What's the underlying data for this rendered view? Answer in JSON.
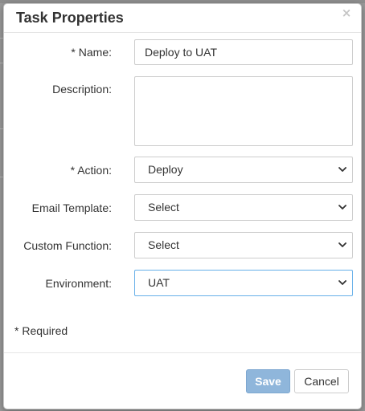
{
  "dialog": {
    "title": "Task Properties",
    "close_glyph": "×"
  },
  "form": {
    "name": {
      "label": "* Name:",
      "value": "Deploy to UAT"
    },
    "description": {
      "label": "Description:",
      "value": ""
    },
    "action": {
      "label": "* Action:",
      "selected": "Deploy"
    },
    "email_template": {
      "label": "Email Template:",
      "selected": "Select"
    },
    "custom_function": {
      "label": "Custom Function:",
      "selected": "Select"
    },
    "environment": {
      "label": "Environment:",
      "selected": "UAT"
    }
  },
  "required_note": "* Required",
  "buttons": {
    "save": "Save",
    "cancel": "Cancel"
  },
  "icons": {
    "close": "close-icon",
    "dropdown": "chevron-down-icon"
  },
  "colors": {
    "primary_disabled": "#8fb6db",
    "focus_border": "#66afe9",
    "text": "#333333"
  }
}
